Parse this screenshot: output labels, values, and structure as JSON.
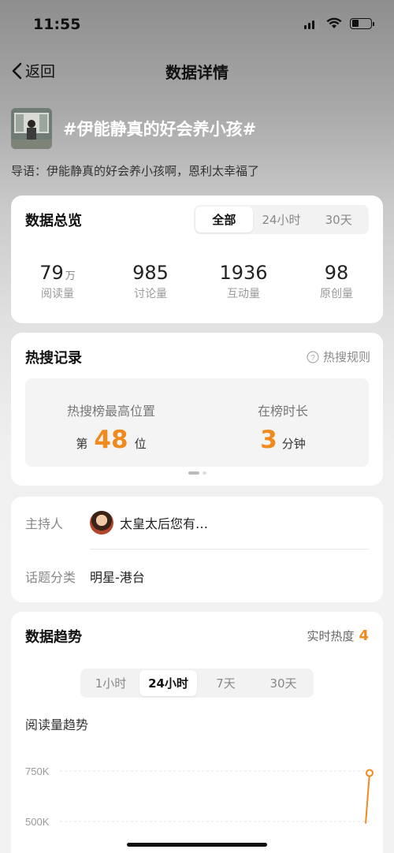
{
  "status": {
    "time": "11:55"
  },
  "nav": {
    "back_label": "返回",
    "title": "数据详情"
  },
  "topic": {
    "title": "#伊能静真的好会养小孩#",
    "intro": "导语：伊能静真的好会养小孩啊，恩利太幸福了"
  },
  "overview": {
    "title": "数据总览",
    "tabs": [
      "全部",
      "24小时",
      "30天"
    ],
    "active_tab": "全部",
    "stats": [
      {
        "value": "79",
        "unit": "万",
        "label": "阅读量"
      },
      {
        "value": "985",
        "unit": "",
        "label": "讨论量"
      },
      {
        "value": "1936",
        "unit": "",
        "label": "互动量"
      },
      {
        "value": "98",
        "unit": "",
        "label": "原创量"
      }
    ]
  },
  "hot_search": {
    "title": "热搜记录",
    "rules_label": "热搜规则",
    "highest_label": "热搜榜最高位置",
    "highest_prefix": "第",
    "highest_value": "48",
    "highest_suffix": "位",
    "duration_label": "在榜时长",
    "duration_value": "3",
    "duration_unit": "分钟"
  },
  "info": {
    "host_label": "主持人",
    "host_name": "太皇太后您有…",
    "category_label": "话题分类",
    "category_value": "明星-港台"
  },
  "trend": {
    "title": "数据趋势",
    "realtime_label": "实时热度",
    "realtime_value": "4",
    "tabs": [
      "1小时",
      "24小时",
      "7天",
      "30天"
    ],
    "active_tab": "24小时",
    "chart_title": "阅读量趋势"
  },
  "chart_data": {
    "type": "line",
    "title": "阅读量趋势",
    "y_ticks": [
      "750K",
      "500K"
    ],
    "series": [
      {
        "values": [
          {
            "y": 490000
          },
          {
            "y": 740000
          }
        ]
      }
    ],
    "color": "#f08a1c",
    "grid": true
  },
  "colors": {
    "accent": "#f08a1c"
  }
}
